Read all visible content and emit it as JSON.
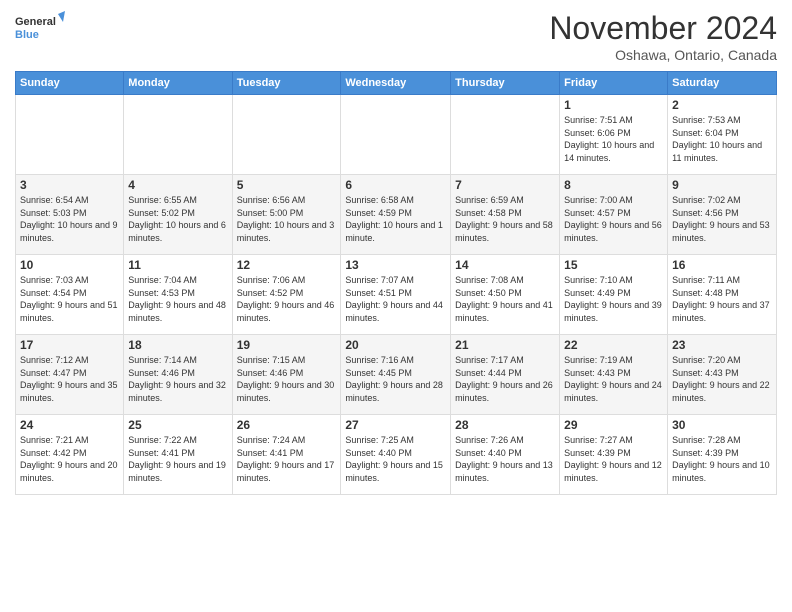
{
  "logo": {
    "line1": "General",
    "line2": "Blue"
  },
  "header": {
    "month": "November 2024",
    "location": "Oshawa, Ontario, Canada"
  },
  "days_of_week": [
    "Sunday",
    "Monday",
    "Tuesday",
    "Wednesday",
    "Thursday",
    "Friday",
    "Saturday"
  ],
  "weeks": [
    [
      {
        "day": "",
        "info": ""
      },
      {
        "day": "",
        "info": ""
      },
      {
        "day": "",
        "info": ""
      },
      {
        "day": "",
        "info": ""
      },
      {
        "day": "",
        "info": ""
      },
      {
        "day": "1",
        "info": "Sunrise: 7:51 AM\nSunset: 6:06 PM\nDaylight: 10 hours and 14 minutes."
      },
      {
        "day": "2",
        "info": "Sunrise: 7:53 AM\nSunset: 6:04 PM\nDaylight: 10 hours and 11 minutes."
      }
    ],
    [
      {
        "day": "3",
        "info": "Sunrise: 6:54 AM\nSunset: 5:03 PM\nDaylight: 10 hours and 9 minutes."
      },
      {
        "day": "4",
        "info": "Sunrise: 6:55 AM\nSunset: 5:02 PM\nDaylight: 10 hours and 6 minutes."
      },
      {
        "day": "5",
        "info": "Sunrise: 6:56 AM\nSunset: 5:00 PM\nDaylight: 10 hours and 3 minutes."
      },
      {
        "day": "6",
        "info": "Sunrise: 6:58 AM\nSunset: 4:59 PM\nDaylight: 10 hours and 1 minute."
      },
      {
        "day": "7",
        "info": "Sunrise: 6:59 AM\nSunset: 4:58 PM\nDaylight: 9 hours and 58 minutes."
      },
      {
        "day": "8",
        "info": "Sunrise: 7:00 AM\nSunset: 4:57 PM\nDaylight: 9 hours and 56 minutes."
      },
      {
        "day": "9",
        "info": "Sunrise: 7:02 AM\nSunset: 4:56 PM\nDaylight: 9 hours and 53 minutes."
      }
    ],
    [
      {
        "day": "10",
        "info": "Sunrise: 7:03 AM\nSunset: 4:54 PM\nDaylight: 9 hours and 51 minutes."
      },
      {
        "day": "11",
        "info": "Sunrise: 7:04 AM\nSunset: 4:53 PM\nDaylight: 9 hours and 48 minutes."
      },
      {
        "day": "12",
        "info": "Sunrise: 7:06 AM\nSunset: 4:52 PM\nDaylight: 9 hours and 46 minutes."
      },
      {
        "day": "13",
        "info": "Sunrise: 7:07 AM\nSunset: 4:51 PM\nDaylight: 9 hours and 44 minutes."
      },
      {
        "day": "14",
        "info": "Sunrise: 7:08 AM\nSunset: 4:50 PM\nDaylight: 9 hours and 41 minutes."
      },
      {
        "day": "15",
        "info": "Sunrise: 7:10 AM\nSunset: 4:49 PM\nDaylight: 9 hours and 39 minutes."
      },
      {
        "day": "16",
        "info": "Sunrise: 7:11 AM\nSunset: 4:48 PM\nDaylight: 9 hours and 37 minutes."
      }
    ],
    [
      {
        "day": "17",
        "info": "Sunrise: 7:12 AM\nSunset: 4:47 PM\nDaylight: 9 hours and 35 minutes."
      },
      {
        "day": "18",
        "info": "Sunrise: 7:14 AM\nSunset: 4:46 PM\nDaylight: 9 hours and 32 minutes."
      },
      {
        "day": "19",
        "info": "Sunrise: 7:15 AM\nSunset: 4:46 PM\nDaylight: 9 hours and 30 minutes."
      },
      {
        "day": "20",
        "info": "Sunrise: 7:16 AM\nSunset: 4:45 PM\nDaylight: 9 hours and 28 minutes."
      },
      {
        "day": "21",
        "info": "Sunrise: 7:17 AM\nSunset: 4:44 PM\nDaylight: 9 hours and 26 minutes."
      },
      {
        "day": "22",
        "info": "Sunrise: 7:19 AM\nSunset: 4:43 PM\nDaylight: 9 hours and 24 minutes."
      },
      {
        "day": "23",
        "info": "Sunrise: 7:20 AM\nSunset: 4:43 PM\nDaylight: 9 hours and 22 minutes."
      }
    ],
    [
      {
        "day": "24",
        "info": "Sunrise: 7:21 AM\nSunset: 4:42 PM\nDaylight: 9 hours and 20 minutes."
      },
      {
        "day": "25",
        "info": "Sunrise: 7:22 AM\nSunset: 4:41 PM\nDaylight: 9 hours and 19 minutes."
      },
      {
        "day": "26",
        "info": "Sunrise: 7:24 AM\nSunset: 4:41 PM\nDaylight: 9 hours and 17 minutes."
      },
      {
        "day": "27",
        "info": "Sunrise: 7:25 AM\nSunset: 4:40 PM\nDaylight: 9 hours and 15 minutes."
      },
      {
        "day": "28",
        "info": "Sunrise: 7:26 AM\nSunset: 4:40 PM\nDaylight: 9 hours and 13 minutes."
      },
      {
        "day": "29",
        "info": "Sunrise: 7:27 AM\nSunset: 4:39 PM\nDaylight: 9 hours and 12 minutes."
      },
      {
        "day": "30",
        "info": "Sunrise: 7:28 AM\nSunset: 4:39 PM\nDaylight: 9 hours and 10 minutes."
      }
    ]
  ]
}
